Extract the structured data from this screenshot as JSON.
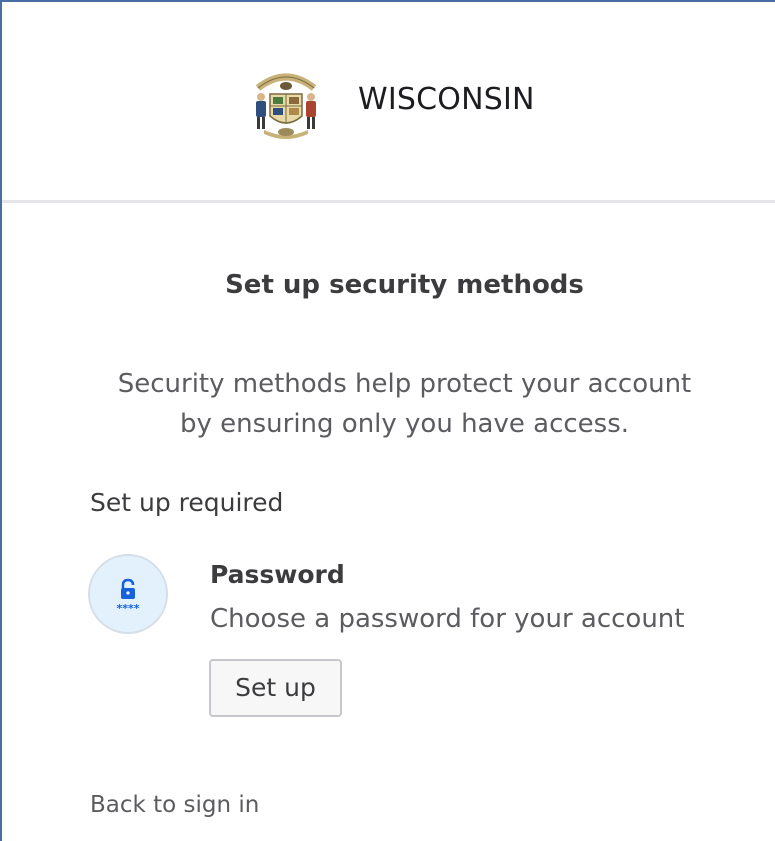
{
  "brand": {
    "logo_icon": "wisconsin-state-seal",
    "name": "WISCONSIN"
  },
  "main": {
    "title": "Set up security methods",
    "subtitle_line1": "Security methods help protect your account",
    "subtitle_line2": "by ensuring only you have access.",
    "section_label": "Set up required",
    "methods": [
      {
        "icon": "password-lock-icon",
        "name": "Password",
        "description": "Choose a password for your account",
        "button_label": "Set up"
      }
    ]
  },
  "footer": {
    "back_link": "Back to sign in"
  },
  "colors": {
    "accent_border": "#4a6fa5",
    "icon_circle_bg": "#e3f1fc",
    "icon_blue": "#1662dd"
  }
}
